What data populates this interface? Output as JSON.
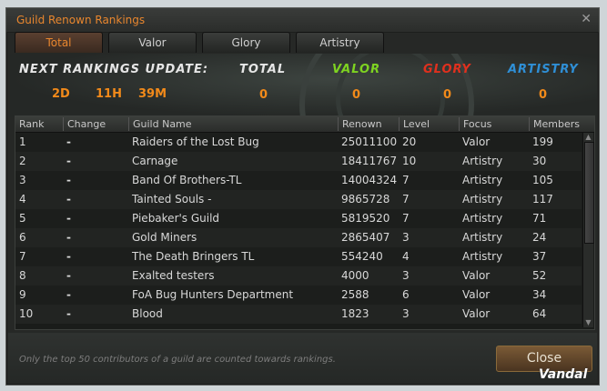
{
  "window": {
    "title": "Guild Renown Rankings",
    "close_symbol": "✕"
  },
  "tabs": [
    {
      "label": "Total",
      "active": true
    },
    {
      "label": "Valor",
      "active": false
    },
    {
      "label": "Glory",
      "active": false
    },
    {
      "label": "Artistry",
      "active": false
    }
  ],
  "summary": {
    "update_label": "NEXT RANKINGS UPDATE:",
    "days": "2D",
    "hours": "11H",
    "minutes": "39M",
    "columns": [
      {
        "label": "TOTAL",
        "value": "0",
        "color": "#e6e6e6"
      },
      {
        "label": "VALOR",
        "value": "0",
        "color": "#7ed321"
      },
      {
        "label": "GLORY",
        "value": "0",
        "color": "#e0301e"
      },
      {
        "label": "ARTISTRY",
        "value": "0",
        "color": "#2f8fd6"
      }
    ]
  },
  "table": {
    "headers": [
      "Rank",
      "Change",
      "Guild Name",
      "Renown",
      "Level",
      "Focus",
      "Members"
    ],
    "rows": [
      [
        "1",
        "-",
        "Raiders of the Lost Bug",
        "25011100",
        "20",
        "Valor",
        "199"
      ],
      [
        "2",
        "-",
        "Carnage",
        "18411767",
        "10",
        "Artistry",
        "30"
      ],
      [
        "3",
        "-",
        "Band Of Brothers-TL",
        "14004324",
        "7",
        "Artistry",
        "105"
      ],
      [
        "4",
        "-",
        "Tainted Souls -",
        "9865728",
        "7",
        "Artistry",
        "117"
      ],
      [
        "5",
        "-",
        "Piebaker's Guild",
        "5819520",
        "7",
        "Artistry",
        "71"
      ],
      [
        "6",
        "-",
        "Gold Miners",
        "2865407",
        "3",
        "Artistry",
        "24"
      ],
      [
        "7",
        "-",
        "The Death Bringers TL",
        "554240",
        "4",
        "Artistry",
        "37"
      ],
      [
        "8",
        "-",
        "Exalted testers",
        "4000",
        "3",
        "Valor",
        "52"
      ],
      [
        "9",
        "-",
        "FoA Bug Hunters Department",
        "2588",
        "6",
        "Valor",
        "34"
      ],
      [
        "10",
        "-",
        "Blood",
        "1823",
        "3",
        "Valor",
        "64"
      ]
    ]
  },
  "footer": {
    "note": "Only the top 50 contributors of a guild are counted towards rankings.",
    "close_label": "Close"
  },
  "watermark": "Vandal"
}
